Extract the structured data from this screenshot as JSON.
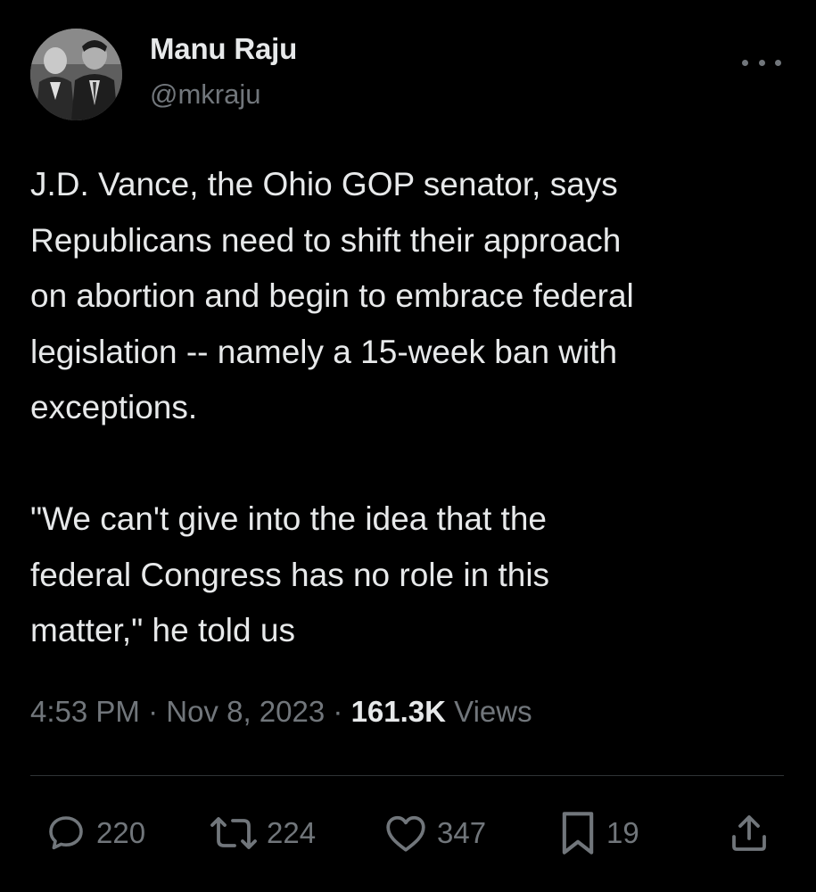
{
  "author": {
    "display_name": "Manu Raju",
    "handle": "@mkraju"
  },
  "tweet": {
    "paragraphs": [
      "J.D. Vance, the Ohio GOP senator, says\nRepublicans need to shift their approach\non abortion and begin to embrace federal\nlegislation -- namely a 15-week ban with\nexceptions.",
      "\"We can't give into the idea that the\nfederal Congress has no role in this\nmatter,\" he told us"
    ]
  },
  "meta": {
    "time": "4:53 PM",
    "separator": "·",
    "date": "Nov 8, 2023",
    "views_count": "161.3K",
    "views_label": "Views"
  },
  "actions": {
    "replies": "220",
    "reposts": "224",
    "likes": "347",
    "bookmarks": "19"
  },
  "icons": {
    "more": "more-horizontal-icon",
    "reply": "speech-bubble-icon",
    "repost": "repost-arrows-icon",
    "like": "heart-icon",
    "bookmark": "bookmark-icon",
    "share": "share-upload-icon"
  },
  "colors": {
    "background": "#000000",
    "primary_text": "#e7e9ea",
    "secondary_text": "#71767b",
    "divider": "#2f3336"
  }
}
